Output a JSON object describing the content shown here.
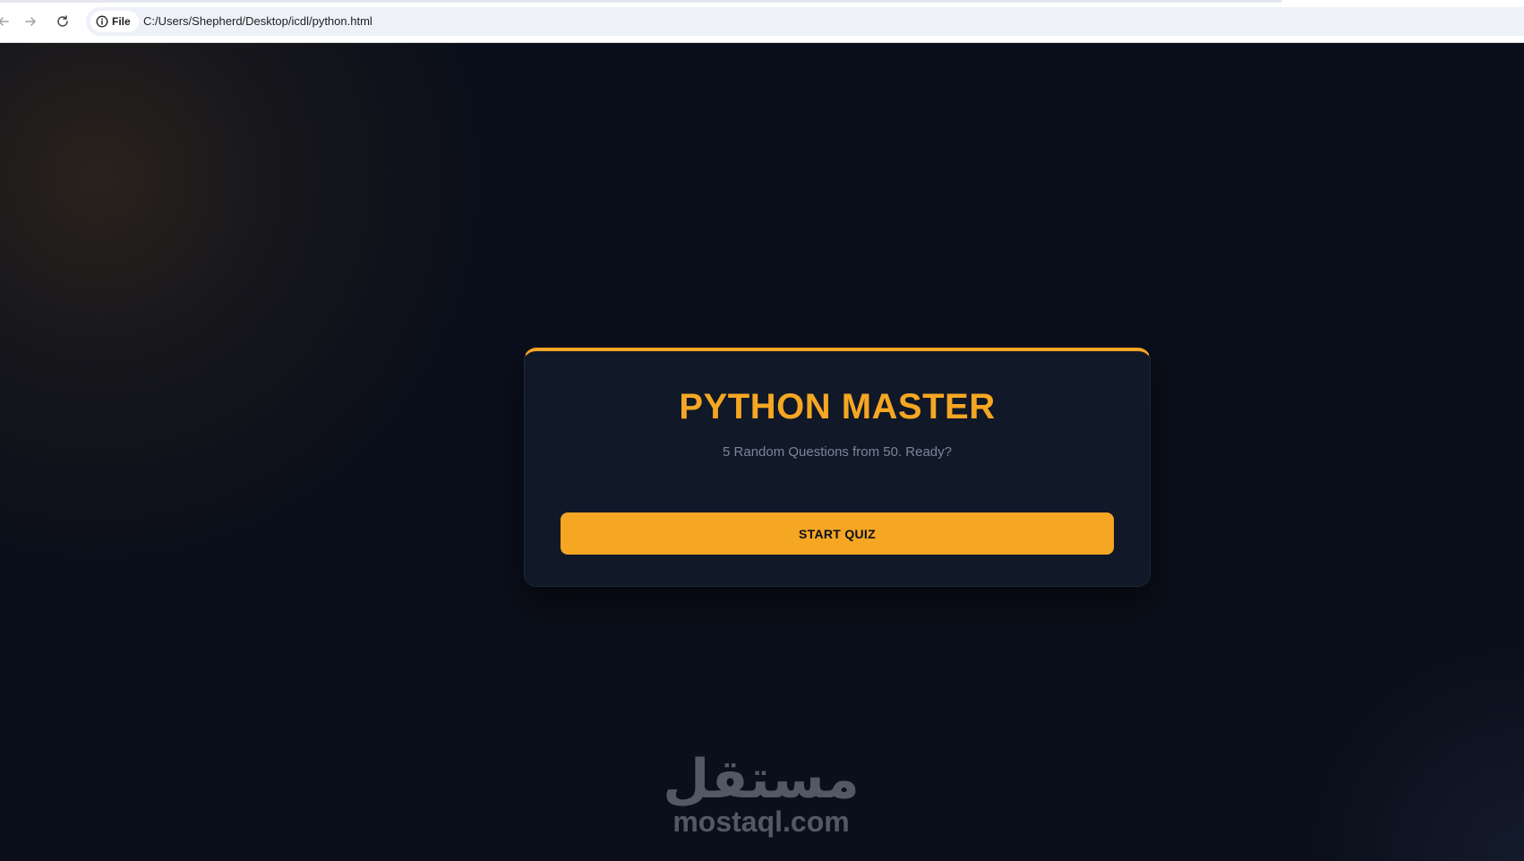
{
  "browser": {
    "site_chip_label": "File",
    "url": "C:/Users/Shepherd/Desktop/icdl/python.html"
  },
  "quiz": {
    "title": "PYTHON MASTER",
    "subtitle": "5 Random Questions from 50. Ready?",
    "start_label": "START QUIZ"
  },
  "watermark": {
    "arabic": "مستقل",
    "latin": "mostaql.com"
  },
  "colors": {
    "accent": "#f5a623",
    "background": "#0b0f1b",
    "card": "#111827",
    "subtitle": "#7c8599"
  }
}
